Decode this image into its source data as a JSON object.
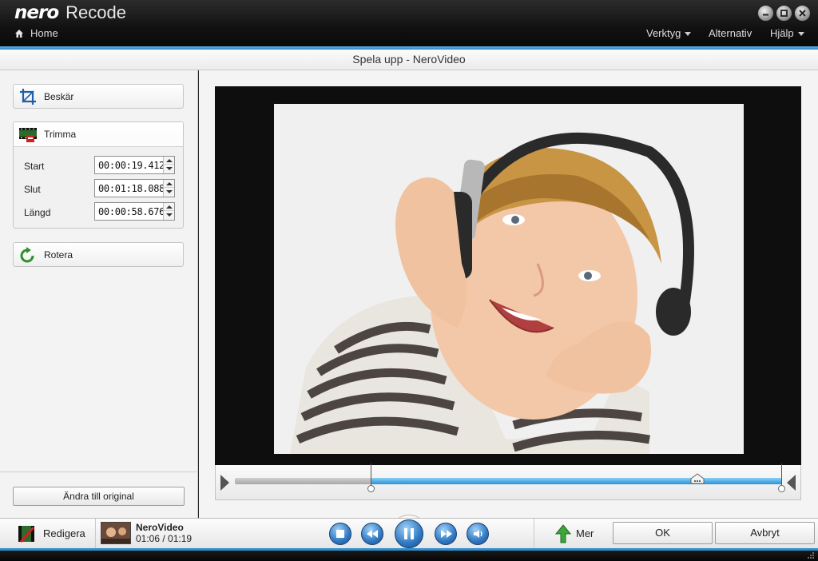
{
  "app": {
    "brand": "nero",
    "product": "Recode",
    "window_title": "Spela upp - NeroVideo"
  },
  "nav": {
    "home_label": "Home"
  },
  "menus": [
    {
      "label": "Verktyg",
      "dropdown": true
    },
    {
      "label": "Alternativ",
      "dropdown": false
    },
    {
      "label": "Hjälp",
      "dropdown": true
    }
  ],
  "tools": {
    "crop_label": "Beskär",
    "trim_label": "Trimma",
    "rotate_label": "Rotera",
    "trim": {
      "start_label": "Start",
      "start_value": "00:00:19.412",
      "end_label": "Slut",
      "end_value": "00:01:18.088",
      "length_label": "Längd",
      "length_value": "00:00:58.676"
    },
    "reset_label": "Ändra till original"
  },
  "timeline": {
    "selection_start": 0.248,
    "selection_end": 1.0,
    "playhead": 0.845
  },
  "bottom": {
    "edit_label": "Redigera",
    "clip_name": "NeroVideo",
    "clip_time": "01:06 / 01:19",
    "more_label": "Mer",
    "ok_label": "OK",
    "cancel_label": "Avbryt"
  },
  "colors": {
    "accent_blue": "#2f8fd0",
    "title_bar": "#111111",
    "panel": "#f3f3f3"
  }
}
